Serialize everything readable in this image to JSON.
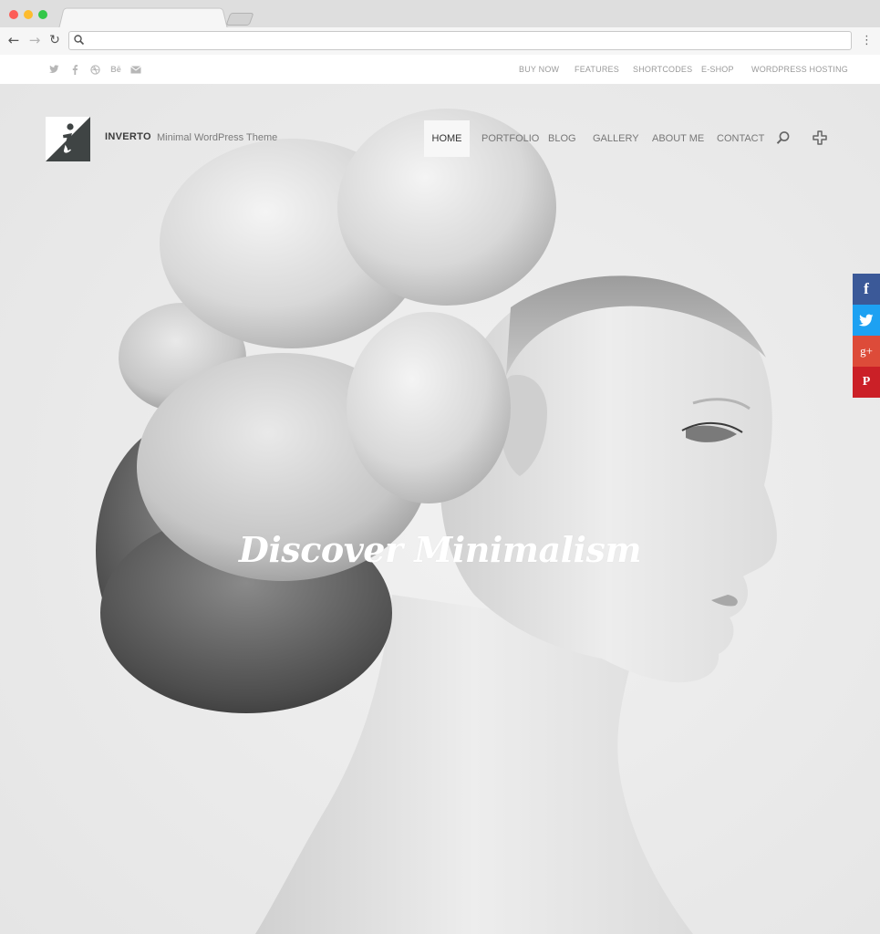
{
  "browser": {
    "address_placeholder": "",
    "address_value": ""
  },
  "topbar": {
    "social": [
      "twitter-icon",
      "facebook-icon",
      "dribbble-icon",
      "behance-icon",
      "mail-icon"
    ],
    "behance_text": "Bē",
    "links": [
      "BUY NOW",
      "FEATURES",
      "SHORTCODES",
      "E-SHOP",
      "WORDPRESS HOSTING"
    ]
  },
  "header": {
    "brand": "INVERTO",
    "tagline": "Minimal WordPress Theme",
    "nav": [
      "HOME",
      "PORTFOLIO",
      "BLOG",
      "GALLERY",
      "ABOUT ME",
      "CONTACT"
    ],
    "active_nav": "HOME"
  },
  "hero": {
    "title": "Discover Minimalism"
  },
  "share": {
    "items": [
      {
        "icon": "facebook-icon",
        "glyph": "f",
        "color": "#3b5998"
      },
      {
        "icon": "twitter-icon",
        "glyph": "",
        "color": "#1da1f2"
      },
      {
        "icon": "google-plus-icon",
        "glyph": "g+",
        "color": "#dd4b39"
      },
      {
        "icon": "pinterest-icon",
        "glyph": "P",
        "color": "#cb2027"
      }
    ]
  },
  "colors": {
    "hero_bg": "#ececec",
    "text_muted": "#9a9a9a",
    "brand": "#3b3b3b"
  }
}
